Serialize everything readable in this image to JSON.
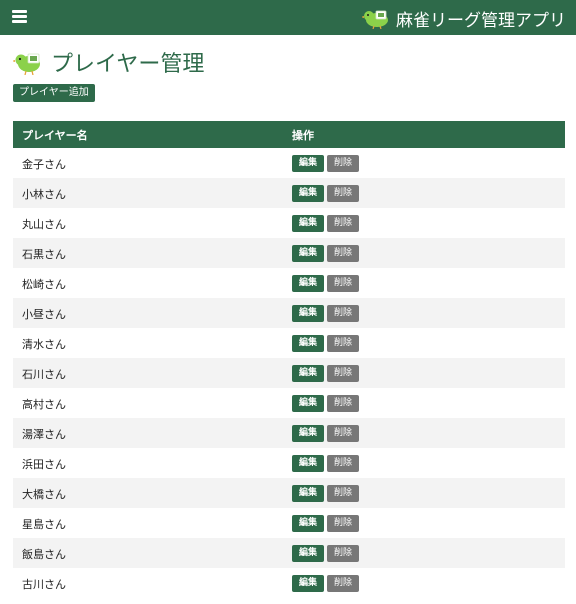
{
  "header": {
    "app_title": "麻雀リーグ管理アプリ"
  },
  "page": {
    "title": "プレイヤー管理",
    "add_button": "プレイヤー追加"
  },
  "table": {
    "columns": [
      "プレイヤー名",
      "操作"
    ],
    "edit_label": "編集",
    "delete_label": "削除",
    "rows": [
      "金子さん",
      "小林さん",
      "丸山さん",
      "石黒さん",
      "松崎さん",
      "小昼さん",
      "清水さん",
      "石川さん",
      "高村さん",
      "湯澤さん",
      "浜田さん",
      "大橋さん",
      "星島さん",
      "飯島さん",
      "古川さん"
    ]
  },
  "colors": {
    "primary": "#2e6a4a",
    "delete": "#777777",
    "row_alt": "#f3f3f3"
  }
}
